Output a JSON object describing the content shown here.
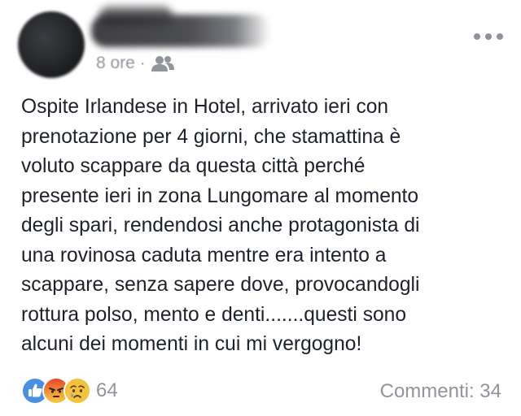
{
  "post": {
    "author_name": "",
    "timestamp": "8 ore",
    "separator": "·",
    "audience_icon": "friends-icon",
    "more_icon": "more-options-icon",
    "text_lines": [
      "Ospite Irlandese in Hotel, arrivato ieri con",
      "prenotazione per 4 giorni, che stamattina è",
      "voluto scappare da questa città perché",
      "presente ieri in zona Lungomare al momento",
      "degli spari, rendendosi anche protagonista di",
      "una rovinosa caduta mentre era intento a",
      "scappare, senza sapere dove, provocandogli",
      "rottura polso, mento e denti.......questi sono",
      "alcuni dei momenti in cui mi vergogno!"
    ]
  },
  "footer": {
    "reactions": [
      "like-icon",
      "angry-icon",
      "sad-icon"
    ],
    "reaction_count": "64",
    "comments_label": "Commenti: 34"
  },
  "colors": {
    "like": "#4a90e2",
    "angry": "#e9412b",
    "sad": "#f5c33b",
    "meta_text": "#90949c",
    "body_text": "#1d2129"
  }
}
